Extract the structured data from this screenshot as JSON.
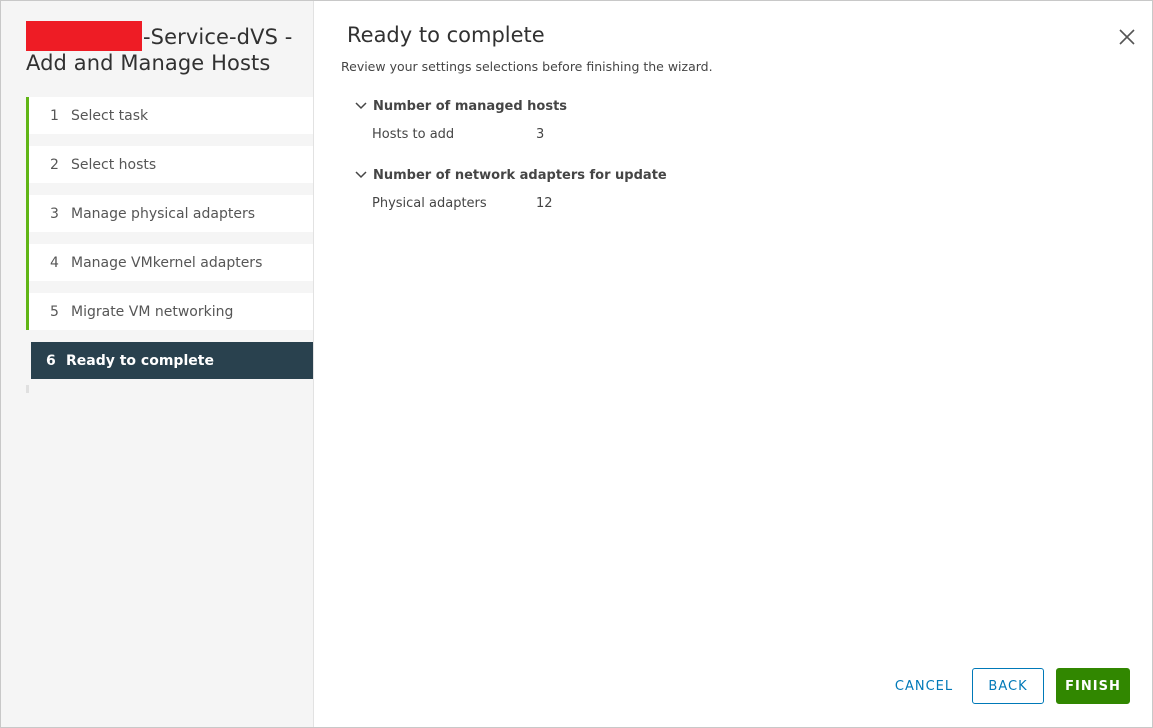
{
  "wizard": {
    "title_suffix": "-Service-dVS -",
    "title_line2": "Add and Manage Hosts"
  },
  "steps": [
    {
      "num": "1",
      "label": "Select task"
    },
    {
      "num": "2",
      "label": "Select hosts"
    },
    {
      "num": "3",
      "label": "Manage physical adapters"
    },
    {
      "num": "4",
      "label": "Manage VMkernel adapters"
    },
    {
      "num": "5",
      "label": "Migrate VM networking"
    },
    {
      "num": "6",
      "label": "Ready to complete"
    }
  ],
  "main": {
    "title": "Ready to complete",
    "subtitle": "Review your settings selections before finishing the wizard.",
    "sections": [
      {
        "heading": "Number of managed hosts",
        "key": "Hosts to add",
        "value": "3"
      },
      {
        "heading": "Number of network adapters for update",
        "key": "Physical adapters",
        "value": "12"
      }
    ]
  },
  "buttons": {
    "cancel": "CANCEL",
    "back": "BACK",
    "finish": "FINISH"
  },
  "colors": {
    "completed_rail": "#60b515",
    "active_step_bg": "#29414e",
    "link_blue": "#0079b8",
    "finish_green": "#318700",
    "redaction": "#ee1c25"
  }
}
